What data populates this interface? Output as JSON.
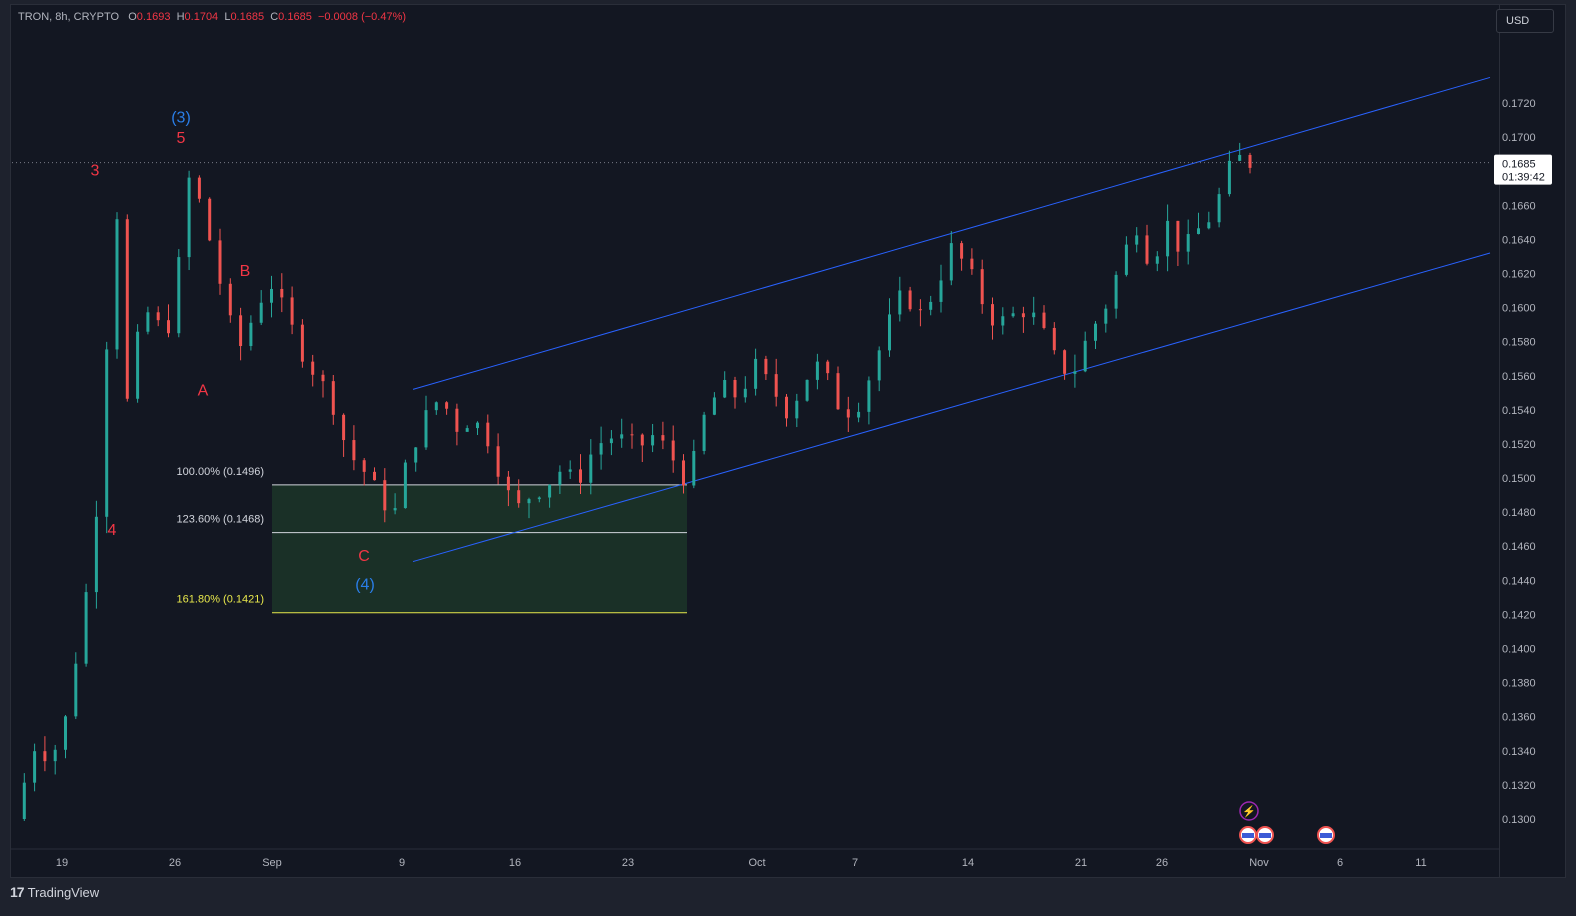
{
  "legend": {
    "symbol": "TRON, 8h, CRYPTO",
    "open_label": "O",
    "open": "0.1693",
    "high_label": "H",
    "high": "0.1704",
    "low_label": "L",
    "low": "0.1685",
    "close_label": "C",
    "close": "0.1685",
    "change": "−0.0008 (−0.47%)"
  },
  "currency": "USD",
  "brand": "TradingView",
  "colors": {
    "background": "#131722",
    "up": "#26a69a",
    "down": "#ef5350",
    "channel": "#2962ff",
    "wave_primary": "#f23645",
    "wave_secondary": "#2a7ee8",
    "fib_zone": "#1e3a2a",
    "fib_161": "#e8e84c"
  },
  "chart_data": {
    "type": "candlestick",
    "timeframe": "8h",
    "ylim": [
      0.129,
      0.1745
    ],
    "x_ticks": [
      "19",
      "26",
      "Sep",
      "9",
      "16",
      "23",
      "Oct",
      "7",
      "14",
      "21",
      "26",
      "Nov",
      "6",
      "11"
    ],
    "y_ticks": [
      "0.1720",
      "0.1700",
      "0.1680",
      "0.1660",
      "0.1640",
      "0.1620",
      "0.1600",
      "0.1580",
      "0.1560",
      "0.1540",
      "0.1520",
      "0.1500",
      "0.1480",
      "0.1460",
      "0.1440",
      "0.1420",
      "0.1400",
      "0.1380",
      "0.1360",
      "0.1340",
      "0.1320",
      "0.1300"
    ],
    "last_price": "0.1685",
    "countdown": "01:39:42",
    "wave_labels": [
      {
        "text": "3",
        "kind": "primary",
        "price": 0.1681
      },
      {
        "text": "4",
        "kind": "primary",
        "price": 0.147
      },
      {
        "text": "(3)",
        "kind": "secondary",
        "price": 0.1712
      },
      {
        "text": "5",
        "kind": "primary",
        "price": 0.17
      },
      {
        "text": "A",
        "kind": "primary",
        "price": 0.1552
      },
      {
        "text": "B",
        "kind": "primary",
        "price": 0.1622
      },
      {
        "text": "C",
        "kind": "primary",
        "price": 0.1455
      },
      {
        "text": "(4)",
        "kind": "secondary",
        "price": 0.1438
      }
    ],
    "fib_levels": [
      {
        "label": "100.00% (0.1496)",
        "price": 0.1496
      },
      {
        "label": "123.60% (0.1468)",
        "price": 0.1468
      },
      {
        "label": "161.80% (0.1421)",
        "price": 0.1421
      }
    ],
    "close_path": [
      [
        0.0,
        0.13
      ],
      [
        0.7,
        0.1345
      ],
      [
        1.2,
        0.1335
      ],
      [
        1.7,
        0.136
      ],
      [
        2.4,
        0.144
      ],
      [
        2.9,
        0.152
      ],
      [
        3.1,
        0.164
      ],
      [
        3.4,
        0.166
      ],
      [
        3.7,
        0.153
      ],
      [
        4.0,
        0.158
      ],
      [
        4.4,
        0.16
      ],
      [
        4.9,
        0.158
      ],
      [
        5.3,
        0.162
      ],
      [
        5.7,
        0.168
      ],
      [
        6.2,
        0.165
      ],
      [
        6.6,
        0.162
      ],
      [
        7.0,
        0.159
      ],
      [
        7.4,
        0.1575
      ],
      [
        7.8,
        0.16
      ],
      [
        8.3,
        0.1615
      ],
      [
        8.8,
        0.1595
      ],
      [
        9.3,
        0.1575
      ],
      [
        9.8,
        0.156
      ],
      [
        10.3,
        0.1545
      ],
      [
        10.8,
        0.1515
      ],
      [
        11.3,
        0.1505
      ],
      [
        11.8,
        0.149
      ],
      [
        12.3,
        0.1478
      ],
      [
        12.8,
        0.1515
      ],
      [
        13.3,
        0.1535
      ],
      [
        13.8,
        0.1548
      ],
      [
        14.3,
        0.153
      ],
      [
        14.8,
        0.1535
      ],
      [
        15.3,
        0.1525
      ],
      [
        15.8,
        0.15
      ],
      [
        16.2,
        0.148
      ],
      [
        16.7,
        0.149
      ],
      [
        17.2,
        0.1496
      ],
      [
        17.7,
        0.1505
      ],
      [
        18.2,
        0.1497
      ],
      [
        18.7,
        0.1515
      ],
      [
        19.2,
        0.1525
      ],
      [
        19.7,
        0.1522
      ],
      [
        20.2,
        0.1518
      ],
      [
        20.7,
        0.1525
      ],
      [
        21.2,
        0.1515
      ],
      [
        21.7,
        0.15
      ],
      [
        22.0,
        0.151
      ],
      [
        22.4,
        0.154
      ],
      [
        22.9,
        0.1553
      ],
      [
        23.4,
        0.1548
      ],
      [
        24.0,
        0.1565
      ],
      [
        24.5,
        0.1553
      ],
      [
        25.0,
        0.154
      ],
      [
        25.4,
        0.155
      ],
      [
        25.9,
        0.1568
      ],
      [
        26.4,
        0.1555
      ],
      [
        26.8,
        0.1538
      ],
      [
        27.3,
        0.1543
      ],
      [
        27.8,
        0.1565
      ],
      [
        28.3,
        0.159
      ],
      [
        28.8,
        0.161
      ],
      [
        29.3,
        0.1595
      ],
      [
        29.8,
        0.161
      ],
      [
        30.3,
        0.1635
      ],
      [
        30.8,
        0.1625
      ],
      [
        31.3,
        0.1605
      ],
      [
        31.8,
        0.159
      ],
      [
        32.3,
        0.1595
      ],
      [
        32.8,
        0.16
      ],
      [
        33.3,
        0.1585
      ],
      [
        33.8,
        0.1565
      ],
      [
        34.3,
        0.1563
      ],
      [
        34.8,
        0.1585
      ],
      [
        35.3,
        0.16
      ],
      [
        35.8,
        0.1625
      ],
      [
        36.3,
        0.165
      ],
      [
        36.8,
        0.1625
      ],
      [
        37.3,
        0.165
      ],
      [
        37.8,
        0.1632
      ],
      [
        38.3,
        0.1645
      ],
      [
        38.8,
        0.1655
      ],
      [
        39.3,
        0.168
      ],
      [
        39.7,
        0.1688
      ],
      [
        40.0,
        0.1685
      ]
    ],
    "markers": [
      "news-flash",
      "us-event",
      "us-event",
      "us-event"
    ]
  }
}
